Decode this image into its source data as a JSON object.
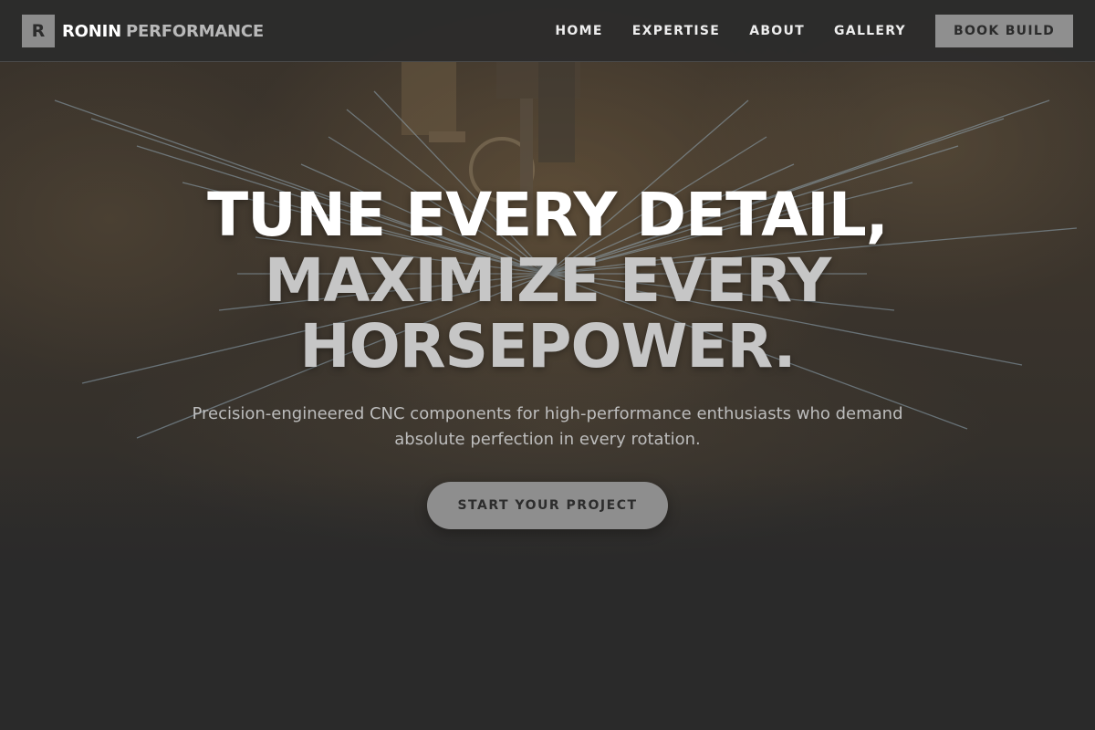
{
  "brand": {
    "mark": "R",
    "name_strong": "RONIN",
    "name_light": "PERFORMANCE"
  },
  "nav": {
    "items": [
      {
        "label": "HOME"
      },
      {
        "label": "EXPERTISE"
      },
      {
        "label": "ABOUT"
      },
      {
        "label": "GALLERY"
      }
    ],
    "cta_label": "BOOK BUILD"
  },
  "hero": {
    "headline_line1": "TUNE EVERY DETAIL,",
    "headline_line2": "MAXIMIZE EVERY",
    "headline_line3": "HORSEPOWER.",
    "subtext": "Precision-engineered CNC components for high-performance enthusiasts who demand absolute perfection in every rotation.",
    "cta_label": "START YOUR PROJECT"
  },
  "colors": {
    "background": "#2a2a2a",
    "header_bg": "#2c2c2c",
    "accent_gray": "#8e8e8e",
    "headline_white": "#ffffff",
    "headline_gray": "#c6c6c6"
  }
}
